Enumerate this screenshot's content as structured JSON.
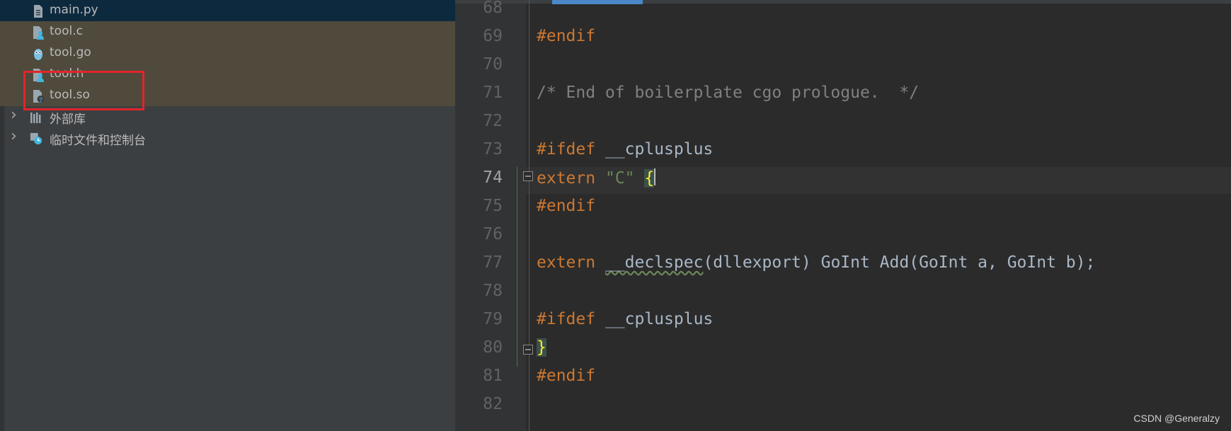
{
  "project_tree": {
    "items": [
      {
        "label": "main.py",
        "icon": "python-file-icon",
        "state": "selected"
      },
      {
        "label": "tool.c",
        "icon": "c-file-icon",
        "state": "changed"
      },
      {
        "label": "tool.go",
        "icon": "go-file-icon",
        "state": "changed"
      },
      {
        "label": "tool.h",
        "icon": "header-file-icon",
        "state": "changed"
      },
      {
        "label": "tool.so",
        "icon": "unknown-file-icon",
        "state": "changed"
      },
      {
        "label": "外部库",
        "icon": "library-icon",
        "state": "normal"
      },
      {
        "label": "临时文件和控制台",
        "icon": "scratches-icon",
        "state": "normal"
      }
    ]
  },
  "editor": {
    "current_line": "74",
    "lines": [
      {
        "n": "68"
      },
      {
        "n": "69",
        "tokens": [
          {
            "t": "#endif",
            "c": "kw"
          }
        ]
      },
      {
        "n": "70"
      },
      {
        "n": "71",
        "tokens": [
          {
            "t": "/* End of boilerplate cgo prologue.  */",
            "c": "cm"
          }
        ]
      },
      {
        "n": "72"
      },
      {
        "n": "73",
        "tokens": [
          {
            "t": "#ifdef",
            "c": "kw"
          },
          {
            "t": " __cplusplus",
            "c": ""
          }
        ]
      },
      {
        "n": "74",
        "tokens": [
          {
            "t": "extern",
            "c": "kw"
          },
          {
            "t": " ",
            "c": ""
          },
          {
            "t": "\"C\"",
            "c": "str"
          },
          {
            "t": " ",
            "c": ""
          },
          {
            "t": "{",
            "c": "hl"
          }
        ]
      },
      {
        "n": "75",
        "tokens": [
          {
            "t": "#endif",
            "c": "kw"
          }
        ]
      },
      {
        "n": "76"
      },
      {
        "n": "77",
        "tokens": [
          {
            "t": "extern",
            "c": "kw"
          },
          {
            "t": " ",
            "c": ""
          },
          {
            "t": "__declspec",
            "c": "squig"
          },
          {
            "t": "(dllexport) GoInt Add(GoInt a, GoInt b);",
            "c": ""
          }
        ]
      },
      {
        "n": "78"
      },
      {
        "n": "79",
        "tokens": [
          {
            "t": "#ifdef",
            "c": "kw"
          },
          {
            "t": " __cplusplus",
            "c": ""
          }
        ]
      },
      {
        "n": "80",
        "tokens": [
          {
            "t": "}",
            "c": "hl"
          }
        ]
      },
      {
        "n": "81",
        "tokens": [
          {
            "t": "#endif",
            "c": "kw"
          }
        ]
      },
      {
        "n": "82"
      }
    ]
  },
  "watermark": "CSDN @Generalzy",
  "colors": {
    "keyword": "#cc7832",
    "comment": "#808080",
    "string": "#6a8759",
    "brace_highlight": "#ffef28",
    "annotation_box": "#e0252c"
  }
}
